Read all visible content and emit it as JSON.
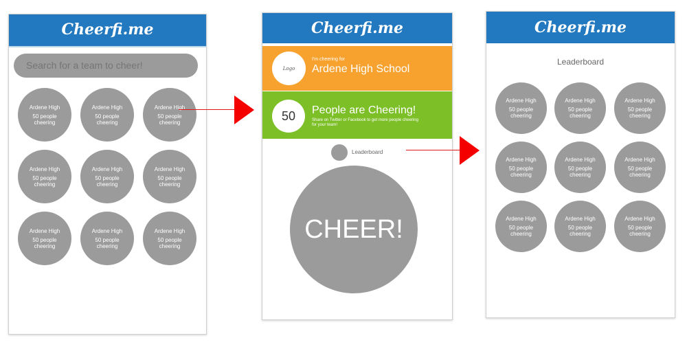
{
  "app_title": "Cheerfi.me",
  "screen1": {
    "search_placeholder": "Search for a team to cheer!",
    "teams": [
      {
        "name": "Ardene High",
        "count": "50 people",
        "label": "cheering"
      },
      {
        "name": "Ardene High",
        "count": "50 people",
        "label": "cheering"
      },
      {
        "name": "Ardene High",
        "count": "50 people",
        "label": "cheering"
      },
      {
        "name": "Ardene High",
        "count": "50 people",
        "label": "cheering"
      },
      {
        "name": "Ardene High",
        "count": "50 people",
        "label": "cheering"
      },
      {
        "name": "Ardene High",
        "count": "50 people",
        "label": "cheering"
      },
      {
        "name": "Ardene High",
        "count": "50 people",
        "label": "cheering"
      },
      {
        "name": "Ardene High",
        "count": "50 people",
        "label": "cheering"
      },
      {
        "name": "Ardene High",
        "count": "50 people",
        "label": "cheering"
      }
    ]
  },
  "screen2": {
    "logo_text": "Logo",
    "cheering_for": "I'm cheering for",
    "school": "Ardene High School",
    "count": "50",
    "people_cheering": "People are Cheering!",
    "share_text": "Share on Twitter or Facebook to get more people cheering for your team!",
    "leaderboard_label": "Leaderboard",
    "cheer_button": "CHEER!"
  },
  "screen3": {
    "title": "Leaderboard",
    "teams": [
      {
        "name": "Ardene High",
        "count": "50 people",
        "label": "cheering"
      },
      {
        "name": "Ardene High",
        "count": "50 people",
        "label": "cheering"
      },
      {
        "name": "Ardene High",
        "count": "50 people",
        "label": "cheering"
      },
      {
        "name": "Ardene High",
        "count": "50 people",
        "label": "cheering"
      },
      {
        "name": "Ardene High",
        "count": "50 people",
        "label": "cheering"
      },
      {
        "name": "Ardene High",
        "count": "50 people",
        "label": "cheering"
      },
      {
        "name": "Ardene High",
        "count": "50 people",
        "label": "cheering"
      },
      {
        "name": "Ardene High",
        "count": "50 people",
        "label": "cheering"
      },
      {
        "name": "Ardene High",
        "count": "50 people",
        "label": "cheering"
      }
    ]
  },
  "colors": {
    "header_blue": "#2279bf",
    "orange": "#f7a12e",
    "green": "#7cbf27",
    "circle_gray": "#9b9b9b",
    "arrow_red": "#f50000"
  }
}
